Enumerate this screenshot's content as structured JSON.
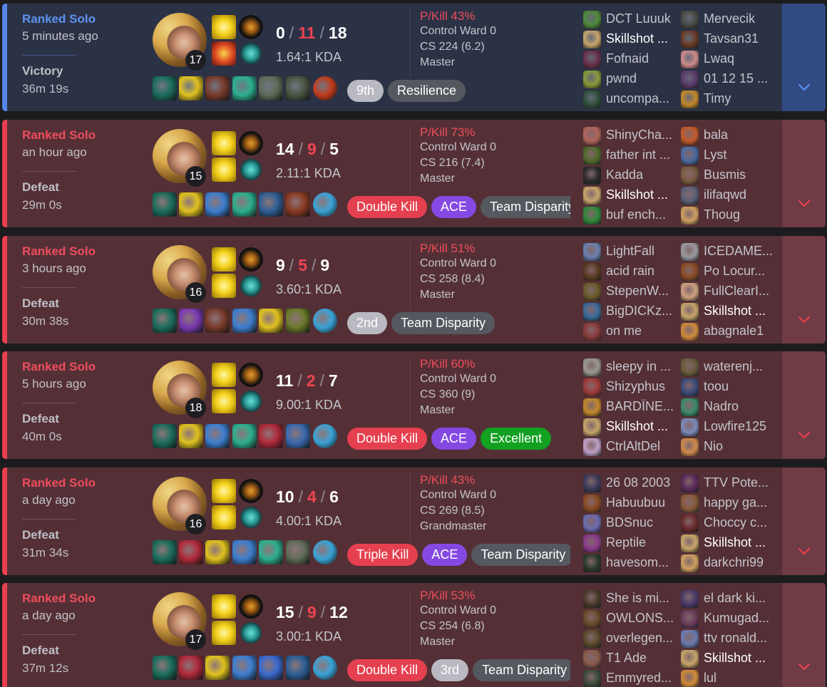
{
  "matches": [
    {
      "outcome": "victory",
      "queue": "Ranked Solo",
      "ago": "5 minutes ago",
      "result": "Victory",
      "duration": "36m 19s",
      "level": "17",
      "kills": "0",
      "deaths": "11",
      "assists": "18",
      "kda": "1.64:1 KDA",
      "pkill": "P/Kill 43%",
      "control_ward": "Control Ward 0",
      "cs": "CS 224 (6.2)",
      "rank": "Master",
      "spell2": "ignite",
      "items": [
        "#1b6e5d",
        "#e0c21f",
        "#7a3b2c",
        "#2cb08f",
        "#5f6b57",
        "#4b5543",
        "#c13b1d"
      ],
      "tags": [
        {
          "text": "9th",
          "style": "silver"
        },
        {
          "text": "Resilience",
          "style": "gray"
        }
      ],
      "team_a": [
        "DCT Luuuk",
        "Skillshot ...",
        "Fofnaid",
        "pwnd",
        "uncompa..."
      ],
      "team_b": [
        "Mervecik",
        "Tavsan31",
        "Lwaq",
        "01 12 15 ...",
        "Timy"
      ],
      "me_index": 1,
      "avatars_a": [
        "#4e8a39",
        "#c8a56a",
        "#6a2f4a",
        "#8a9a3a",
        "#2f4f3a"
      ],
      "avatars_b": [
        "#4a4a44",
        "#6a3a26",
        "#d08a8a",
        "#5a3a6a",
        "#c4892a"
      ]
    },
    {
      "outcome": "defeat",
      "queue": "Ranked Solo",
      "ago": "an hour ago",
      "result": "Defeat",
      "duration": "29m 0s",
      "level": "15",
      "kills": "14",
      "deaths": "9",
      "assists": "5",
      "kda": "2.11:1 KDA",
      "pkill": "P/Kill 73%",
      "control_ward": "Control Ward 0",
      "cs": "CS 216 (7.4)",
      "rank": "Master",
      "spell2": "flash-cleanse",
      "items": [
        "#1b6e5d",
        "#e0c21f",
        "#3d7fd0",
        "#2cb08f",
        "#2e5f96",
        "#8a3a22",
        "#3aa3d6"
      ],
      "tags": [
        {
          "text": "Double Kill",
          "style": "red"
        },
        {
          "text": "ACE",
          "style": "purple"
        },
        {
          "text": "Team Disparity",
          "style": "gray"
        }
      ],
      "team_a": [
        "ShinyCha...",
        "father int ...",
        "Kadda",
        "Skillshot ...",
        "buf ench..."
      ],
      "team_b": [
        "bala",
        "Lyst",
        "Busmis",
        "ilifaqwd",
        "Thoug"
      ],
      "me_index": 3,
      "avatars_a": [
        "#b0645a",
        "#4e6a2a",
        "#2a2a2a",
        "#c8a56a",
        "#2f8a3a"
      ],
      "avatars_b": [
        "#c45a2a",
        "#4a6aa0",
        "#7a5a40",
        "#5a6078",
        "#d0a060"
      ]
    },
    {
      "outcome": "defeat",
      "queue": "Ranked Solo",
      "ago": "3 hours ago",
      "result": "Defeat",
      "duration": "30m 38s",
      "level": "16",
      "kills": "9",
      "deaths": "5",
      "assists": "9",
      "kda": "3.60:1 KDA",
      "pkill": "P/Kill 51%",
      "control_ward": "Control Ward 0",
      "cs": "CS 258 (8.4)",
      "rank": "Master",
      "spell2": "flash",
      "items": [
        "#1b6e5d",
        "#7a3ab0",
        "#7a3b2c",
        "#3d7fd0",
        "#e0c21f",
        "#6a7a2a",
        "#3aa3d6"
      ],
      "tags": [
        {
          "text": "2nd",
          "style": "silver"
        },
        {
          "text": "Team Disparity",
          "style": "gray"
        }
      ],
      "team_a": [
        "LightFall",
        "acid rain",
        "StepenW...",
        "BigDICKz...",
        "on me"
      ],
      "team_b": [
        "ICEDAME...",
        "Po Locur...",
        "FullClearI...",
        "Skillshot ...",
        "abagnale1"
      ],
      "me_index_b": 3,
      "avatars_a": [
        "#6a80b0",
        "#5a3a20",
        "#6a5a2a",
        "#3a6a9a",
        "#8a3a3a"
      ],
      "avatars_b": [
        "#9a9aa0",
        "#8a4a22",
        "#d0a080",
        "#c8a56a",
        "#d08a3a"
      ]
    },
    {
      "outcome": "defeat",
      "queue": "Ranked Solo",
      "ago": "5 hours ago",
      "result": "Defeat",
      "duration": "40m 0s",
      "level": "18",
      "kills": "11",
      "deaths": "2",
      "assists": "7",
      "kda": "9.00:1 KDA",
      "pkill": "P/Kill 60%",
      "control_ward": "Control Ward 0",
      "cs": "CS 360 (9)",
      "rank": "Master",
      "spell2": "flash",
      "items": [
        "#1b6e5d",
        "#e0c21f",
        "#3d7fd0",
        "#2cb08f",
        "#b02a3a",
        "#3a6ab0",
        "#3aa3d6"
      ],
      "tags": [
        {
          "text": "Double Kill",
          "style": "red"
        },
        {
          "text": "ACE",
          "style": "purple"
        },
        {
          "text": "Excellent",
          "style": "green"
        }
      ],
      "team_a": [
        "sleepy in ...",
        "Shizyphus",
        "BARDÏNE...",
        "Skillshot ...",
        "CtrlAltDel"
      ],
      "team_b": [
        "waterenj...",
        "toou",
        "Nadro",
        "Lowfire125",
        "Nio"
      ],
      "me_index": 3,
      "avatars_a": [
        "#9a9a90",
        "#a03a3a",
        "#c4892a",
        "#c8a56a",
        "#c0a0c8"
      ],
      "avatars_b": [
        "#6a5a3a",
        "#3a4a7a",
        "#3a8a6a",
        "#7a8ab8",
        "#d08a4a"
      ]
    },
    {
      "outcome": "defeat",
      "queue": "Ranked Solo",
      "ago": "a day ago",
      "result": "Defeat",
      "duration": "31m 34s",
      "level": "16",
      "kills": "10",
      "deaths": "4",
      "assists": "6",
      "kda": "4.00:1 KDA",
      "pkill": "P/Kill 43%",
      "control_ward": "Control Ward 0",
      "cs": "CS 269 (8.5)",
      "rank": "Grandmaster",
      "spell2": "flash",
      "items": [
        "#1b6e5d",
        "#b02a3a",
        "#e0c21f",
        "#3d7fd0",
        "#2cb08f",
        "#5f6b57",
        "#3aa3d6"
      ],
      "tags": [
        {
          "text": "Triple Kill",
          "style": "red"
        },
        {
          "text": "ACE",
          "style": "purple"
        },
        {
          "text": "Team Disparity",
          "style": "gray"
        }
      ],
      "team_a": [
        "26 08 2003",
        "Habuubuu",
        "BDSnuc",
        "Reptile",
        "havesom..."
      ],
      "team_b": [
        "TTV Pote...",
        "happy ga...",
        "Choccy c...",
        "Skillshot ...",
        "darkchri99"
      ],
      "me_index_b": 3,
      "avatars_a": [
        "#3a3a5a",
        "#8a4a22",
        "#6a6ab0",
        "#8a3a8a",
        "#2a3a2a"
      ],
      "avatars_b": [
        "#5a2a5a",
        "#8a5a3a",
        "#6a2a2a",
        "#c8a56a",
        "#d0a060"
      ]
    },
    {
      "outcome": "defeat",
      "queue": "Ranked Solo",
      "ago": "a day ago",
      "result": "Defeat",
      "duration": "37m 12s",
      "level": "17",
      "kills": "15",
      "deaths": "9",
      "assists": "12",
      "kda": "3.00:1 KDA",
      "pkill": "P/Kill 53%",
      "control_ward": "Control Ward 0",
      "cs": "CS 254 (6.8)",
      "rank": "Master",
      "spell2": "flash",
      "items": [
        "#1b6e5d",
        "#b02a3a",
        "#e0c21f",
        "#3d7fd0",
        "#3a6ad0",
        "#2e5f96",
        "#3aa3d6"
      ],
      "tags": [
        {
          "text": "Double Kill",
          "style": "red"
        },
        {
          "text": "3rd",
          "style": "silver"
        },
        {
          "text": "Team Disparity",
          "style": "gray"
        }
      ],
      "team_a": [
        "She is mi...",
        "OWLONS...",
        "overlegen...",
        "T1 Ade",
        "Emmyred..."
      ],
      "team_b": [
        "el dark ki...",
        "Kumugad...",
        "ttv ronald...",
        "Skillshot ...",
        "lul"
      ],
      "me_index_b": 3,
      "avatars_a": [
        "#4a3a2a",
        "#6a4a2a",
        "#5a4a2a",
        "#8a5a4a",
        "#3a4a3a"
      ],
      "avatars_b": [
        "#4a3a6a",
        "#6a3a5a",
        "#6a7ab0",
        "#c8a56a",
        "#d08a3a"
      ]
    }
  ]
}
